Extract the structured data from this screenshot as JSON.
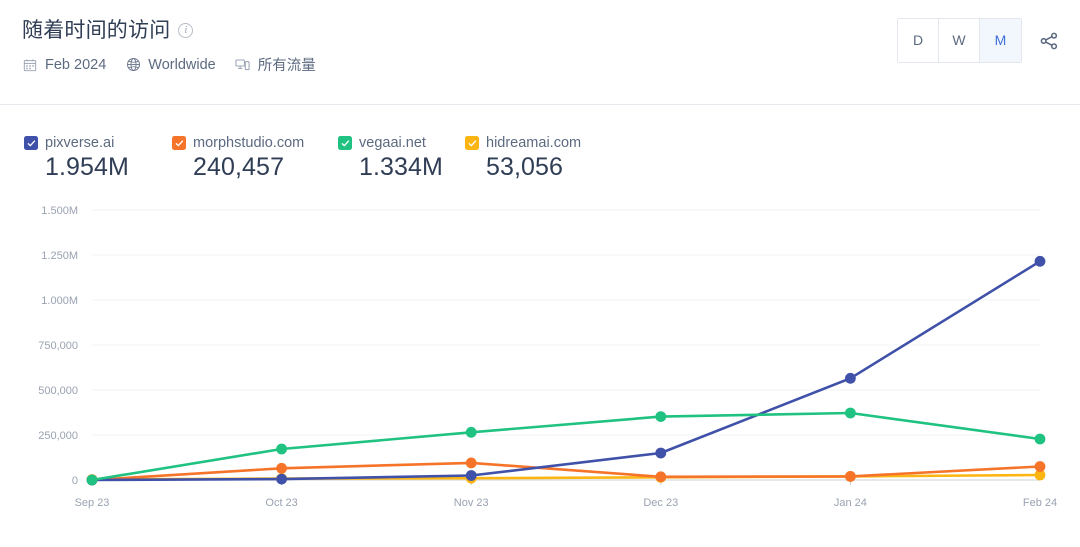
{
  "header": {
    "title": "随着时间的访问",
    "info_icon": "info-icon",
    "meta": {
      "date_icon": "calendar-icon",
      "date": "Feb 2024",
      "location_icon": "globe-icon",
      "location": "Worldwide",
      "device_icon": "devices-icon",
      "device": "所有流量"
    },
    "granularity": {
      "options": [
        {
          "label": "D",
          "active": false
        },
        {
          "label": "W",
          "active": false
        },
        {
          "label": "M",
          "active": true
        }
      ]
    },
    "share_icon": "share-icon"
  },
  "legend": [
    {
      "name": "pixverse.ai",
      "value": "1.954M",
      "color": "#3f51a8",
      "checked": true
    },
    {
      "name": "morphstudio.com",
      "value": "240,457",
      "color": "#f5742a",
      "checked": true
    },
    {
      "name": "vegaai.net",
      "value": "1.334M",
      "color": "#1fc281",
      "checked": true
    },
    {
      "name": "hidreamai.com",
      "value": "53,056",
      "color": "#fcb614",
      "checked": true
    }
  ],
  "chart_data": {
    "type": "line",
    "title": "随着时间的访问",
    "xlabel": "",
    "ylabel": "",
    "categories": [
      "Sep 23",
      "Oct 23",
      "Nov 23",
      "Dec 23",
      "Jan 24",
      "Feb 24"
    ],
    "ytick_labels": [
      "0",
      "250,000",
      "500,000",
      "750,000",
      "1.000M",
      "1.250M",
      "1.500M"
    ],
    "ytick_values": [
      0,
      250000,
      500000,
      750000,
      1000000,
      1250000,
      1500000
    ],
    "ylim": [
      0,
      1500000
    ],
    "grid": true,
    "legend_position": "top-left",
    "series": [
      {
        "name": "pixverse.ai",
        "color": "#3f51a8",
        "values": [
          0,
          5000,
          25000,
          150000,
          565000,
          1215000
        ]
      },
      {
        "name": "morphstudio.com",
        "color": "#f5742a",
        "values": [
          0,
          65000,
          95000,
          18000,
          20000,
          75000
        ]
      },
      {
        "name": "vegaai.net",
        "color": "#1fc281",
        "values": [
          0,
          172000,
          265000,
          352000,
          372000,
          228000
        ]
      },
      {
        "name": "hidreamai.com",
        "color": "#fcb614",
        "values": [
          3000,
          8000,
          10000,
          15000,
          20000,
          28000
        ]
      }
    ]
  }
}
